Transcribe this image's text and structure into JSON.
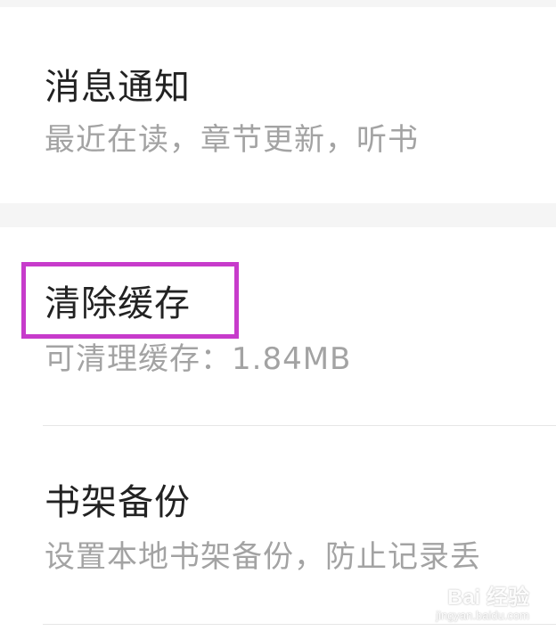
{
  "settings": {
    "items": [
      {
        "title": "消息通知",
        "subtitle": "最近在读，章节更新，听书"
      },
      {
        "title": "清除缓存",
        "subtitle": "可清理缓存：1.84MB"
      },
      {
        "title": "书架备份",
        "subtitle": "设置本地书架备份，防止记录丢"
      }
    ]
  },
  "highlight": {
    "color": "#c73bcb",
    "target": "清除缓存"
  },
  "watermark": {
    "main": "Bai 经验",
    "sub": "jingyan.baidu.com"
  }
}
